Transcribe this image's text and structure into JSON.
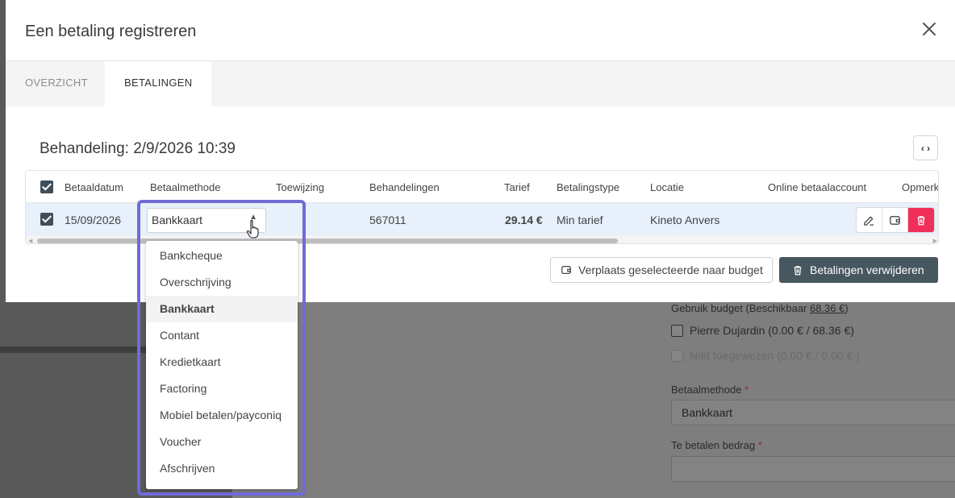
{
  "background": {
    "budget_text": "Gebruik budget (Beschikbaar ",
    "budget_amount": "68.36 €",
    "budget_close": ")",
    "options": [
      {
        "label": "Pierre Dujardin (0.00 € / 68.36 €)"
      },
      {
        "label": "Niet toegewezen (0.00 € / 0.00 € )"
      }
    ],
    "payment_method_label": "Betaalmethode",
    "payment_method_value": "Bankkaart",
    "amount_label": "Te betalen bedrag",
    "required_marker": "*"
  },
  "modal": {
    "title": "Een betaling registreren",
    "tabs": [
      {
        "label": "OVERZICHT"
      },
      {
        "label": "BETALINGEN"
      }
    ],
    "section_title": "Behandeling: 2/9/2026 10:39",
    "table": {
      "headers": [
        "Betaaldatum",
        "Betaalmethode",
        "Toewijzing",
        "Behandelingen",
        "Tarief",
        "Betalingstype",
        "Locatie",
        "Online betaalaccount",
        "Opmerk"
      ],
      "row": {
        "betaaldatum": "15/09/2026",
        "betaalmethode": "Bankkaart",
        "toewijzing": "",
        "behandelingen": "567011",
        "tarief": "29.14 €",
        "betalingstype": "Min tarief",
        "locatie": "Kineto Anvers"
      }
    },
    "buttons": {
      "move_to_budget": "Verplaats geselecteerde naar budget",
      "delete_payments": "Betalingen verwijderen"
    }
  },
  "dropdown": {
    "items": [
      {
        "label": "Bankcheque"
      },
      {
        "label": "Overschrijving"
      },
      {
        "label": "Bankkaart"
      },
      {
        "label": "Contant"
      },
      {
        "label": "Kredietkaart"
      },
      {
        "label": "Factoring"
      },
      {
        "label": "Mobiel betalen/payconiq"
      },
      {
        "label": "Voucher"
      },
      {
        "label": "Afschrijven"
      }
    ],
    "selected": "Bankkaart"
  },
  "colors": {
    "highlight": "#6f6bd6",
    "delete_icon_bg": "#f0305a",
    "primary_button": "#47575f",
    "selected_row": "#e7f0fb"
  }
}
